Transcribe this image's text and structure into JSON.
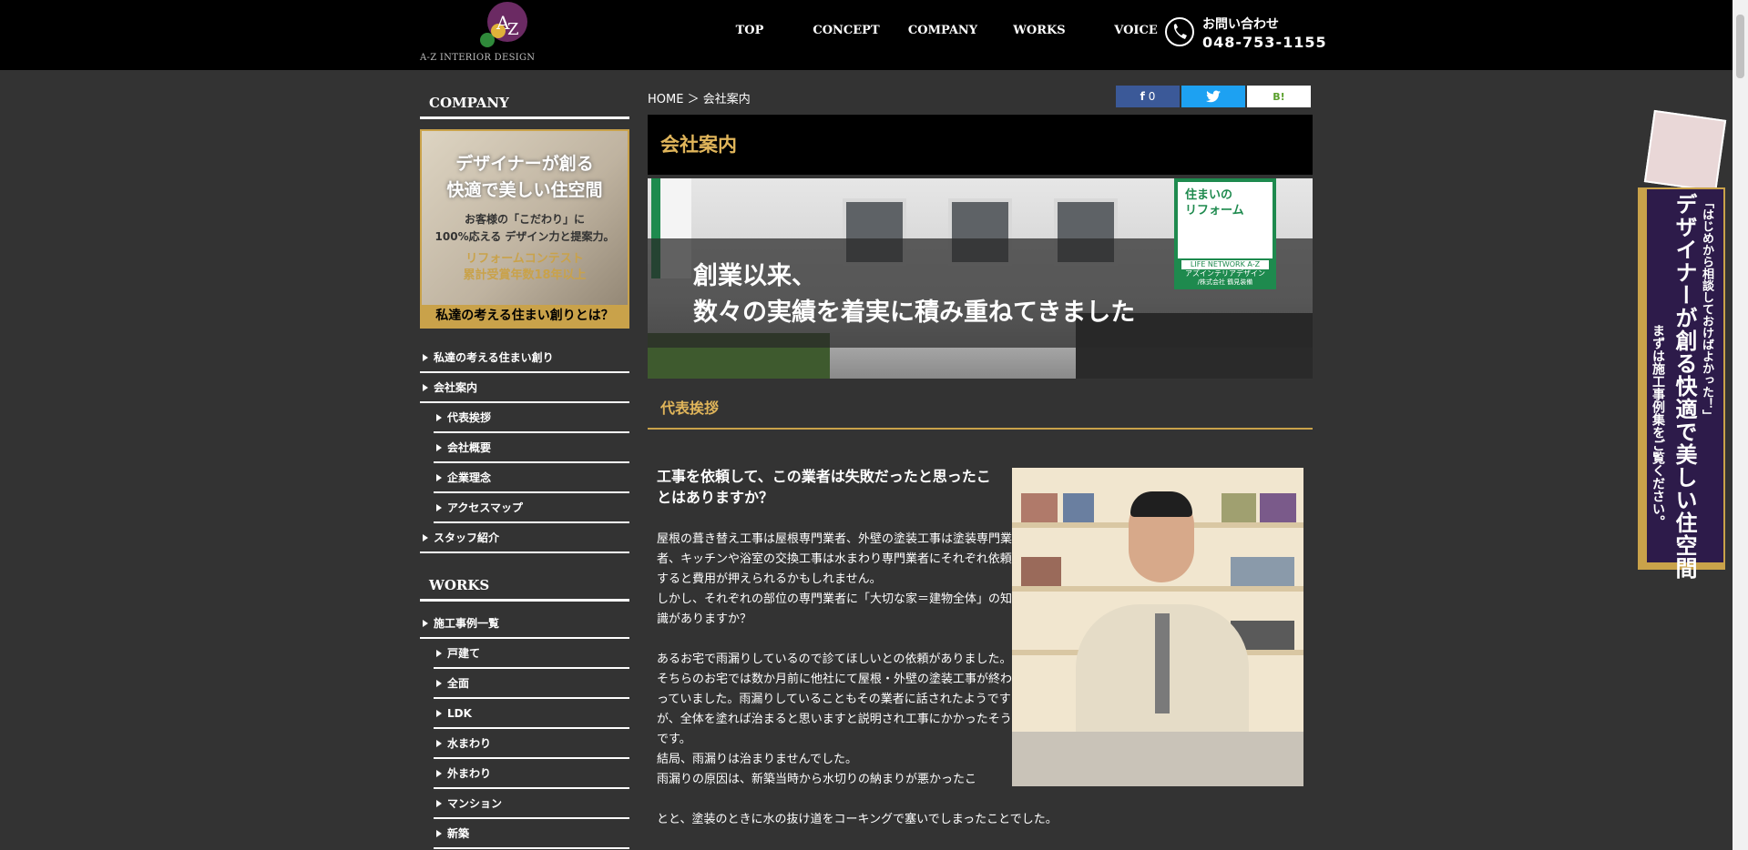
{
  "header": {
    "logo_text": "A-Z INTERIOR DESIGN",
    "nav": [
      "TOP",
      "CONCEPT",
      "COMPANY",
      "WORKS",
      "VOICE"
    ],
    "contact_label": "お問い合わせ",
    "contact_phone": "048-753-1155"
  },
  "sidebar": {
    "company_heading": "COMPANY",
    "banner": {
      "title_line1": "デザイナーが創る",
      "title_line2": "快適で美しい住空間",
      "sub_line1": "お客様の「こだわり」に",
      "sub_line2": "100%応える デザイン力と提案力。",
      "award_line1": "リフォームコンテスト",
      "award_line2": "累計受賞年数18年以上",
      "footer": "私達の考える住まい創りとは？"
    },
    "company_items": [
      {
        "label": "私達の考える住まい創り",
        "sub": false
      },
      {
        "label": "会社案内",
        "sub": false
      },
      {
        "label": "代表挨拶",
        "sub": true
      },
      {
        "label": "会社概要",
        "sub": true
      },
      {
        "label": "企業理念",
        "sub": true
      },
      {
        "label": "アクセスマップ",
        "sub": true
      },
      {
        "label": "スタッフ紹介",
        "sub": false
      }
    ],
    "works_heading": "WORKS",
    "works_items": [
      {
        "label": "施工事例一覧",
        "sub": false
      },
      {
        "label": "戸建て",
        "sub": true
      },
      {
        "label": "全面",
        "sub": true
      },
      {
        "label": "LDK",
        "sub": true
      },
      {
        "label": "水まわり",
        "sub": true
      },
      {
        "label": "外まわり",
        "sub": true
      },
      {
        "label": "マンション",
        "sub": true
      },
      {
        "label": "新築",
        "sub": true
      }
    ]
  },
  "main": {
    "breadcrumb": "HOME ＞ 会社案内",
    "share": {
      "facebook_count": "0"
    },
    "page_title": "会社案内",
    "hero": {
      "line1": "創業以来、",
      "line2": "数々の実績を着実に積み重ねてきました",
      "sign_line1": "住まいの",
      "sign_line2": "リフォーム",
      "sign_brand": "LIFE NETWORK A-Z",
      "sign_company": "アズインテリアデザイン",
      "sign_sub": "/株式会社 鶴見装備"
    },
    "section_title": "代表挨拶",
    "lead": "工事を依頼して、この業者は失敗だったと思ったことはありますか？",
    "paragraph1": "屋根の葺き替え工事は屋根専門業者、外壁の塗装工事は塗装専門業者、キッチンや浴室の交換工事は水まわり専門業者にそれぞれ依頼すると費用が押えられるかもしれません。",
    "paragraph2": "しかし、それぞれの部位の専門業者に「大切な家＝建物全体」の知識がありますか？",
    "paragraph3": "あるお宅で雨漏りしているので診てほしいとの依頼がありました。",
    "paragraph4": "そちらのお宅では数か月前に他社にて屋根・外壁の塗装工事が終わっていました。雨漏りしていることもその業者に話されたようですが、全体を塗れば治まると思いますと説明され工事にかかったそうです。",
    "paragraph5": "結局、雨漏りは治まりませんでした。",
    "paragraph6_a": "雨漏りの原因は、新築当時から水切りの納まりが悪かったこ",
    "paragraph6_b": "とと、塗装のときに水の抜け道をコーキングで塞いでしまったことでした。"
  },
  "float_banner": {
    "line1": "「はじめから相談しておけばよかった！」",
    "line2": "デザイナーが創る快適で美しい住空間",
    "line3": "まずは施工事例集をご覧ください。"
  },
  "colors": {
    "accent": "#c9a24a",
    "header_bg": "#000000",
    "page_bg": "#333333"
  }
}
